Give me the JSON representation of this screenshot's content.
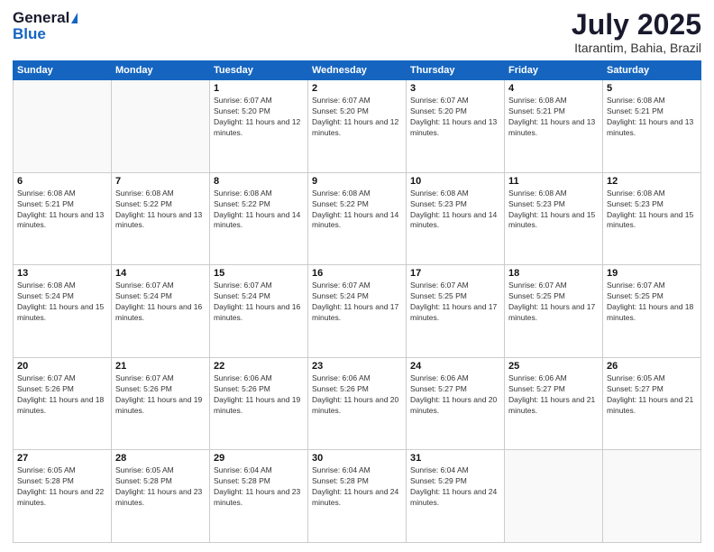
{
  "logo": {
    "general": "General",
    "blue": "Blue"
  },
  "title": {
    "month_year": "July 2025",
    "location": "Itarantim, Bahia, Brazil"
  },
  "headers": [
    "Sunday",
    "Monday",
    "Tuesday",
    "Wednesday",
    "Thursday",
    "Friday",
    "Saturday"
  ],
  "weeks": [
    [
      {
        "day": "",
        "sunrise": "",
        "sunset": "",
        "daylight": ""
      },
      {
        "day": "",
        "sunrise": "",
        "sunset": "",
        "daylight": ""
      },
      {
        "day": "1",
        "sunrise": "Sunrise: 6:07 AM",
        "sunset": "Sunset: 5:20 PM",
        "daylight": "Daylight: 11 hours and 12 minutes."
      },
      {
        "day": "2",
        "sunrise": "Sunrise: 6:07 AM",
        "sunset": "Sunset: 5:20 PM",
        "daylight": "Daylight: 11 hours and 12 minutes."
      },
      {
        "day": "3",
        "sunrise": "Sunrise: 6:07 AM",
        "sunset": "Sunset: 5:20 PM",
        "daylight": "Daylight: 11 hours and 13 minutes."
      },
      {
        "day": "4",
        "sunrise": "Sunrise: 6:08 AM",
        "sunset": "Sunset: 5:21 PM",
        "daylight": "Daylight: 11 hours and 13 minutes."
      },
      {
        "day": "5",
        "sunrise": "Sunrise: 6:08 AM",
        "sunset": "Sunset: 5:21 PM",
        "daylight": "Daylight: 11 hours and 13 minutes."
      }
    ],
    [
      {
        "day": "6",
        "sunrise": "Sunrise: 6:08 AM",
        "sunset": "Sunset: 5:21 PM",
        "daylight": "Daylight: 11 hours and 13 minutes."
      },
      {
        "day": "7",
        "sunrise": "Sunrise: 6:08 AM",
        "sunset": "Sunset: 5:22 PM",
        "daylight": "Daylight: 11 hours and 13 minutes."
      },
      {
        "day": "8",
        "sunrise": "Sunrise: 6:08 AM",
        "sunset": "Sunset: 5:22 PM",
        "daylight": "Daylight: 11 hours and 14 minutes."
      },
      {
        "day": "9",
        "sunrise": "Sunrise: 6:08 AM",
        "sunset": "Sunset: 5:22 PM",
        "daylight": "Daylight: 11 hours and 14 minutes."
      },
      {
        "day": "10",
        "sunrise": "Sunrise: 6:08 AM",
        "sunset": "Sunset: 5:23 PM",
        "daylight": "Daylight: 11 hours and 14 minutes."
      },
      {
        "day": "11",
        "sunrise": "Sunrise: 6:08 AM",
        "sunset": "Sunset: 5:23 PM",
        "daylight": "Daylight: 11 hours and 15 minutes."
      },
      {
        "day": "12",
        "sunrise": "Sunrise: 6:08 AM",
        "sunset": "Sunset: 5:23 PM",
        "daylight": "Daylight: 11 hours and 15 minutes."
      }
    ],
    [
      {
        "day": "13",
        "sunrise": "Sunrise: 6:08 AM",
        "sunset": "Sunset: 5:24 PM",
        "daylight": "Daylight: 11 hours and 15 minutes."
      },
      {
        "day": "14",
        "sunrise": "Sunrise: 6:07 AM",
        "sunset": "Sunset: 5:24 PM",
        "daylight": "Daylight: 11 hours and 16 minutes."
      },
      {
        "day": "15",
        "sunrise": "Sunrise: 6:07 AM",
        "sunset": "Sunset: 5:24 PM",
        "daylight": "Daylight: 11 hours and 16 minutes."
      },
      {
        "day": "16",
        "sunrise": "Sunrise: 6:07 AM",
        "sunset": "Sunset: 5:24 PM",
        "daylight": "Daylight: 11 hours and 17 minutes."
      },
      {
        "day": "17",
        "sunrise": "Sunrise: 6:07 AM",
        "sunset": "Sunset: 5:25 PM",
        "daylight": "Daylight: 11 hours and 17 minutes."
      },
      {
        "day": "18",
        "sunrise": "Sunrise: 6:07 AM",
        "sunset": "Sunset: 5:25 PM",
        "daylight": "Daylight: 11 hours and 17 minutes."
      },
      {
        "day": "19",
        "sunrise": "Sunrise: 6:07 AM",
        "sunset": "Sunset: 5:25 PM",
        "daylight": "Daylight: 11 hours and 18 minutes."
      }
    ],
    [
      {
        "day": "20",
        "sunrise": "Sunrise: 6:07 AM",
        "sunset": "Sunset: 5:26 PM",
        "daylight": "Daylight: 11 hours and 18 minutes."
      },
      {
        "day": "21",
        "sunrise": "Sunrise: 6:07 AM",
        "sunset": "Sunset: 5:26 PM",
        "daylight": "Daylight: 11 hours and 19 minutes."
      },
      {
        "day": "22",
        "sunrise": "Sunrise: 6:06 AM",
        "sunset": "Sunset: 5:26 PM",
        "daylight": "Daylight: 11 hours and 19 minutes."
      },
      {
        "day": "23",
        "sunrise": "Sunrise: 6:06 AM",
        "sunset": "Sunset: 5:26 PM",
        "daylight": "Daylight: 11 hours and 20 minutes."
      },
      {
        "day": "24",
        "sunrise": "Sunrise: 6:06 AM",
        "sunset": "Sunset: 5:27 PM",
        "daylight": "Daylight: 11 hours and 20 minutes."
      },
      {
        "day": "25",
        "sunrise": "Sunrise: 6:06 AM",
        "sunset": "Sunset: 5:27 PM",
        "daylight": "Daylight: 11 hours and 21 minutes."
      },
      {
        "day": "26",
        "sunrise": "Sunrise: 6:05 AM",
        "sunset": "Sunset: 5:27 PM",
        "daylight": "Daylight: 11 hours and 21 minutes."
      }
    ],
    [
      {
        "day": "27",
        "sunrise": "Sunrise: 6:05 AM",
        "sunset": "Sunset: 5:28 PM",
        "daylight": "Daylight: 11 hours and 22 minutes."
      },
      {
        "day": "28",
        "sunrise": "Sunrise: 6:05 AM",
        "sunset": "Sunset: 5:28 PM",
        "daylight": "Daylight: 11 hours and 23 minutes."
      },
      {
        "day": "29",
        "sunrise": "Sunrise: 6:04 AM",
        "sunset": "Sunset: 5:28 PM",
        "daylight": "Daylight: 11 hours and 23 minutes."
      },
      {
        "day": "30",
        "sunrise": "Sunrise: 6:04 AM",
        "sunset": "Sunset: 5:28 PM",
        "daylight": "Daylight: 11 hours and 24 minutes."
      },
      {
        "day": "31",
        "sunrise": "Sunrise: 6:04 AM",
        "sunset": "Sunset: 5:29 PM",
        "daylight": "Daylight: 11 hours and 24 minutes."
      },
      {
        "day": "",
        "sunrise": "",
        "sunset": "",
        "daylight": ""
      },
      {
        "day": "",
        "sunrise": "",
        "sunset": "",
        "daylight": ""
      }
    ]
  ]
}
